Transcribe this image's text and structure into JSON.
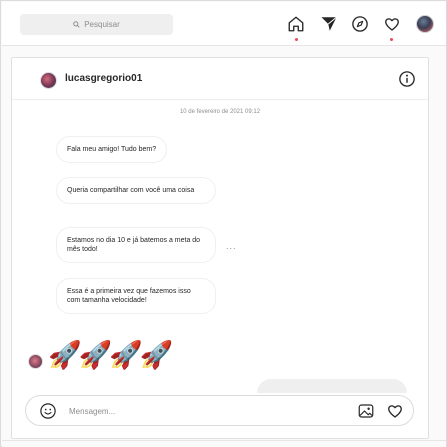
{
  "topbar": {
    "search": {
      "placeholder": "Pesquisar",
      "icon": "search-icon"
    },
    "nav_icons": [
      "home-icon",
      "direct-icon",
      "explore-icon",
      "activity-icon",
      "profile-avatar"
    ],
    "accent_notification": "#ed4956"
  },
  "conversation": {
    "username": "lucasgregorio01",
    "timestamp": "10 de fevereiro de 2021 09:12",
    "messages": [
      {
        "text": "Fala meu amigo! Tudo bem?"
      },
      {
        "text": "Queria compartilhar com você uma coisa"
      },
      {
        "text": "Estamos no dia 10 e já batemos a meta do mês todo!"
      },
      {
        "text": "Essa é a primeira vez que fazemos isso com tamanha velocidade!"
      }
    ],
    "more_label": "...",
    "emoji_message": "🚀🚀🚀🚀"
  },
  "composer": {
    "placeholder": "Mensagem...",
    "icons": [
      "emoji-icon",
      "image-icon",
      "heart-icon"
    ]
  },
  "colors": {
    "background": "#fafafa",
    "panel": "#ffffff",
    "border": "#dbdbdb",
    "muted_text": "#8e8e8e"
  }
}
